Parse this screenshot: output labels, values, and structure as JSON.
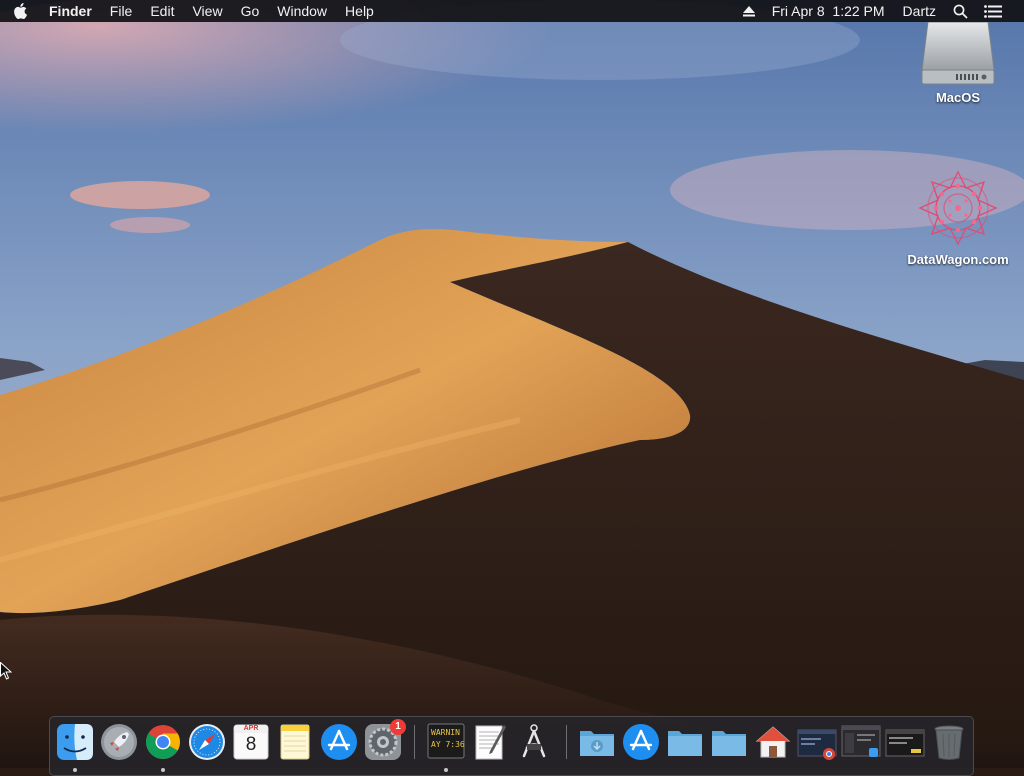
{
  "menubar": {
    "apple_icon": "apple-logo-icon",
    "app_name": "Finder",
    "menus": [
      "File",
      "Edit",
      "View",
      "Go",
      "Window",
      "Help"
    ],
    "eject_icon": "eject-icon",
    "datetime": "Fri Apr 8  1:22 PM",
    "user": "Dartz",
    "search_icon": "spotlight-search-icon",
    "notification_icon": "notification-center-icon"
  },
  "desktop": {
    "icons": [
      {
        "name": "hard-drive-icon",
        "label": "MacOS"
      },
      {
        "name": "datawagon-icon",
        "label": "DataWagon.com"
      }
    ]
  },
  "dock": {
    "calendar": {
      "month": "APR",
      "day": "8"
    },
    "system_preferences_badge": "1",
    "console": {
      "lines": "WARNIN\nAY 7:36"
    },
    "items": [
      "finder-icon",
      "launchpad-icon",
      "chrome-icon",
      "safari-icon",
      "calendar-icon",
      "notes-icon",
      "app-store-icon",
      "system-preferences-icon",
      "console-icon",
      "textedit-icon",
      "script-editor-icon",
      "downloads-folder-icon",
      "applications-folder-icon",
      "documents-folder-icon",
      "folder-icon",
      "home-folder-icon",
      "chrome-window-icon",
      "finder-window-icon",
      "terminal-window-icon",
      "trash-icon"
    ]
  },
  "colors": {
    "menubar_bg": "#121216",
    "sky_top": "#5a7cb0",
    "dune_light": "#d9974a",
    "dune_shadow": "#2e1f18",
    "badge_red": "#f03a36"
  }
}
